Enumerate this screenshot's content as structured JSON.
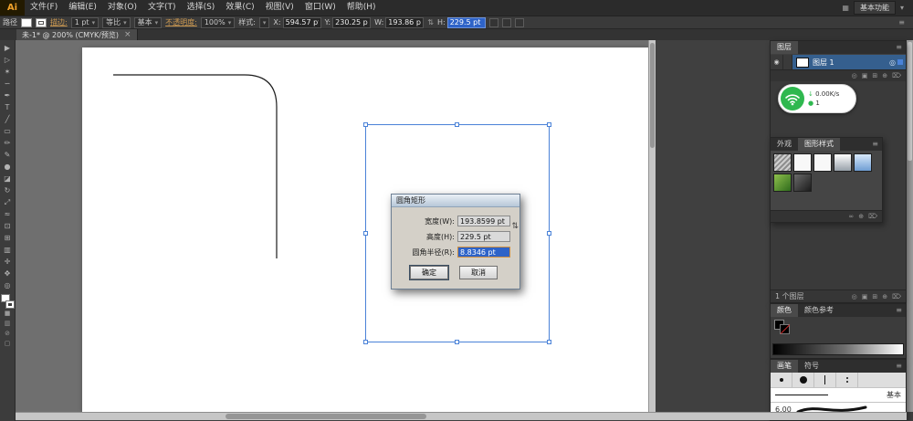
{
  "colors": {
    "accent_blue": "#4a82d8",
    "ui_green": "#2fb84f",
    "selection_blue": "#2e63c8",
    "logo_orange": "#f0a22b"
  },
  "menubar": {
    "logo": "Ai",
    "items": [
      "文件(F)",
      "编辑(E)",
      "对象(O)",
      "文字(T)",
      "选择(S)",
      "效果(C)",
      "视图(V)",
      "窗口(W)",
      "帮助(H)"
    ],
    "workspace_label": "基本功能"
  },
  "controlbar": {
    "object_type": "路径",
    "stroke_label": "描边:",
    "stroke_weight": "1 pt",
    "width_profile": "等比",
    "brush_name": "基本",
    "opacity_label": "不透明度:",
    "opacity_value": "100%",
    "style_label": "样式:",
    "x_label": "X:",
    "x_value": "594.57 pt",
    "y_label": "Y:",
    "y_value": "230.25 pt",
    "w_label": "W:",
    "w_value": "193.86 pt",
    "h_label": "H:",
    "h_value": "229.5 pt"
  },
  "tabbar": {
    "title": "未-1* @ 200% (CMYK/预览)"
  },
  "tools": [
    {
      "name": "selection-tool",
      "glyph": "▶"
    },
    {
      "name": "direct-selection-tool",
      "glyph": "▷"
    },
    {
      "name": "magic-wand-tool",
      "glyph": "✶"
    },
    {
      "name": "lasso-tool",
      "glyph": "∽"
    },
    {
      "name": "pen-tool",
      "glyph": "✒"
    },
    {
      "name": "type-tool",
      "glyph": "T"
    },
    {
      "name": "line-segment-tool",
      "glyph": "╱"
    },
    {
      "name": "rectangle-tool",
      "glyph": "▭"
    },
    {
      "name": "paintbrush-tool",
      "glyph": "✏"
    },
    {
      "name": "pencil-tool",
      "glyph": "✎"
    },
    {
      "name": "blob-brush-tool",
      "glyph": "●"
    },
    {
      "name": "eraser-tool",
      "glyph": "◪"
    },
    {
      "name": "rotate-tool",
      "glyph": "↻"
    },
    {
      "name": "scale-tool",
      "glyph": "⤢"
    },
    {
      "name": "width-tool",
      "glyph": "≈"
    },
    {
      "name": "free-transform-tool",
      "glyph": "⊡"
    },
    {
      "name": "shape-builder-tool",
      "glyph": "⊞"
    },
    {
      "name": "gradient-tool",
      "glyph": "▥"
    },
    {
      "name": "eyedropper-tool",
      "glyph": "✛"
    },
    {
      "name": "hand-tool",
      "glyph": "✥"
    },
    {
      "name": "zoom-tool",
      "glyph": "◎"
    }
  ],
  "dialog": {
    "title": "圆角矩形",
    "width_label": "宽度(W):",
    "width_value": "193.8599 pt",
    "height_label": "高度(H):",
    "height_value": "229.5 pt",
    "radius_label": "圆角半径(R):",
    "radius_value": "8.8346 pt",
    "ok_label": "确定",
    "cancel_label": "取消"
  },
  "layers_panel": {
    "tab": "图层",
    "layer_name": "图层 1",
    "status": "1 个图层"
  },
  "network_widget": {
    "speed": "0.00K/s",
    "count": "1"
  },
  "styles_panel": {
    "tab_appearance": "外观",
    "tab_styles": "图形样式"
  },
  "color_panel": {
    "tab_color": "颜色",
    "tab_guide": "颜色参考"
  },
  "brushes_panel": {
    "tab_brushes": "画笔",
    "tab_symbols": "符号",
    "basic_label": "基本",
    "size_label": "6.00"
  },
  "icons": {
    "chevron_down": "▾",
    "menu": "≡",
    "close": "×",
    "grid": "▦",
    "link_dims": "⇅",
    "eye": "◉",
    "target": "◎",
    "locate": "◎",
    "clip": "▣",
    "sublayer": "⊞",
    "new": "⊕",
    "trash": "⌦",
    "unlink": "∞",
    "down": "↓",
    "shield": "●"
  }
}
